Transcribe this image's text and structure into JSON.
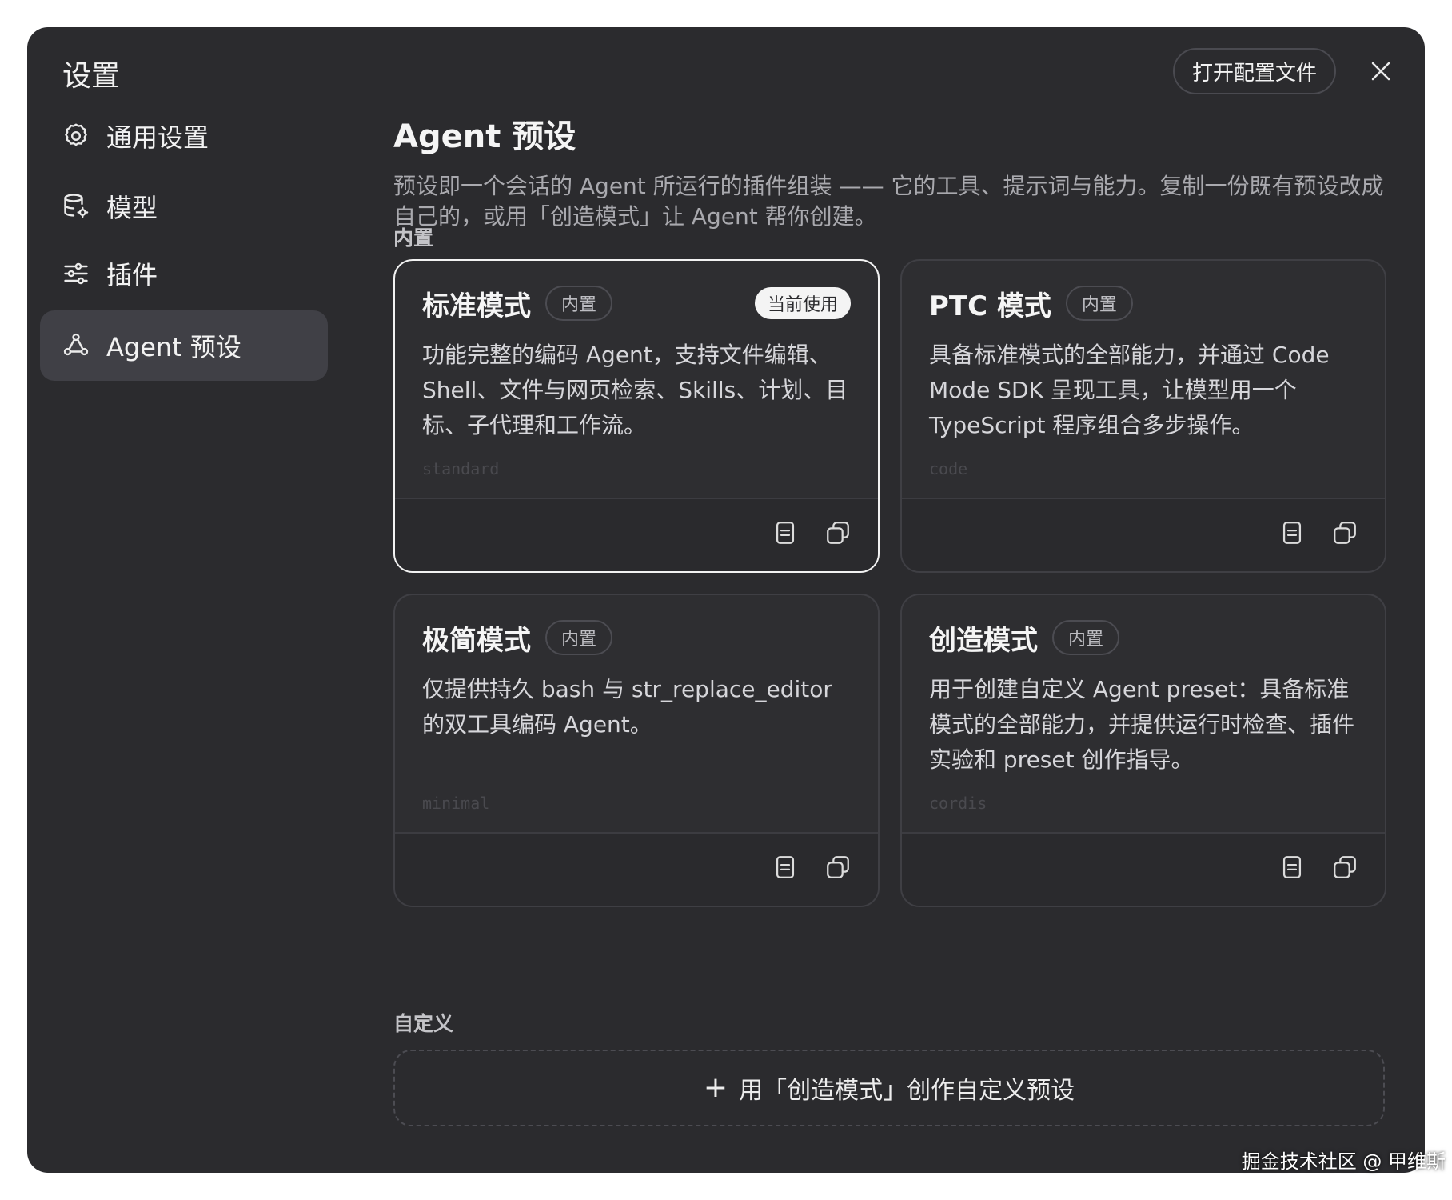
{
  "dialog": {
    "title": "设置",
    "open_config_label": "打开配置文件"
  },
  "sidebar": {
    "items": [
      {
        "label": "通用设置",
        "icon": "gear-icon"
      },
      {
        "label": "模型",
        "icon": "database-gear-icon"
      },
      {
        "label": "插件",
        "icon": "sliders-icon"
      },
      {
        "label": "Agent 预设",
        "icon": "agent-nodes-icon",
        "active": true
      }
    ]
  },
  "main": {
    "title": "Agent 预设",
    "description": "预设即一个会话的 Agent 所运行的插件组装 —— 它的工具、提示词与能力。复制一份既有预设改成自己的，或用「创造模式」让 Agent 帮你创建。",
    "builtin_label": "内置",
    "custom_label": "自定义",
    "create_custom_label": "用「创造模式」创作自定义预设",
    "cards": [
      {
        "title": "标准模式",
        "badge": "内置",
        "current_badge": "当前使用",
        "description": "功能完整的编码 Agent，支持文件编辑、Shell、文件与网页检索、Skills、计划、目标、子代理和工作流。",
        "id": "standard",
        "selected": true
      },
      {
        "title": "PTC 模式",
        "badge": "内置",
        "description": "具备标准模式的全部能力，并通过 Code Mode SDK 呈现工具，让模型用一个 TypeScript 程序组合多步操作。",
        "id": "code"
      },
      {
        "title": "极简模式",
        "badge": "内置",
        "description": "仅提供持久 bash 与 str_replace_editor 的双工具编码 Agent。",
        "id": "minimal"
      },
      {
        "title": "创造模式",
        "badge": "内置",
        "description": "用于创建自定义 Agent preset：具备标准模式的全部能力，并提供运行时检查、插件实验和 preset 创作指导。",
        "id": "cordis"
      }
    ]
  },
  "watermark": "掘金技术社区 @ 甲维斯",
  "colors": {
    "dialog_bg": "#2b2b2e",
    "card_bg": "#2e2e31",
    "sidebar_active_bg": "#404046",
    "text_primary": "#f5f5f5",
    "text_secondary": "#a9a9ae"
  }
}
